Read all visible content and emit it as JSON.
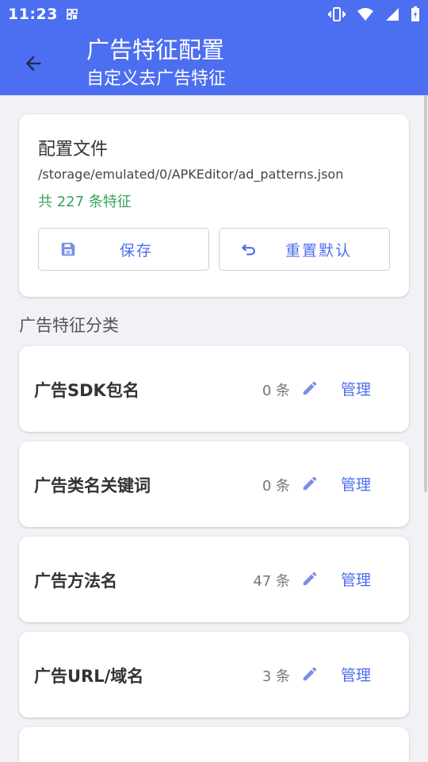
{
  "status_bar": {
    "time": "11:23"
  },
  "app_bar": {
    "title": "广告特征配置",
    "subtitle": "自定义去广告特征"
  },
  "config": {
    "title": "配置文件",
    "path": "/storage/emulated/0/APKEditor/ad_patterns.json",
    "count": "共 227 条特征",
    "save_label": "保存",
    "reset_label": "重置默认"
  },
  "section_title": "广告特征分类",
  "categories": [
    {
      "name": "广告SDK包名",
      "count": "0 条",
      "action": "管理"
    },
    {
      "name": "广告类名关键词",
      "count": "0 条",
      "action": "管理"
    },
    {
      "name": "广告方法名",
      "count": "47 条",
      "action": "管理"
    },
    {
      "name": "广告URL/域名",
      "count": "3 条",
      "action": "管理"
    }
  ],
  "colors": {
    "primary": "#4c6ef0",
    "success": "#3aa35a",
    "background": "#f1f2f6"
  }
}
